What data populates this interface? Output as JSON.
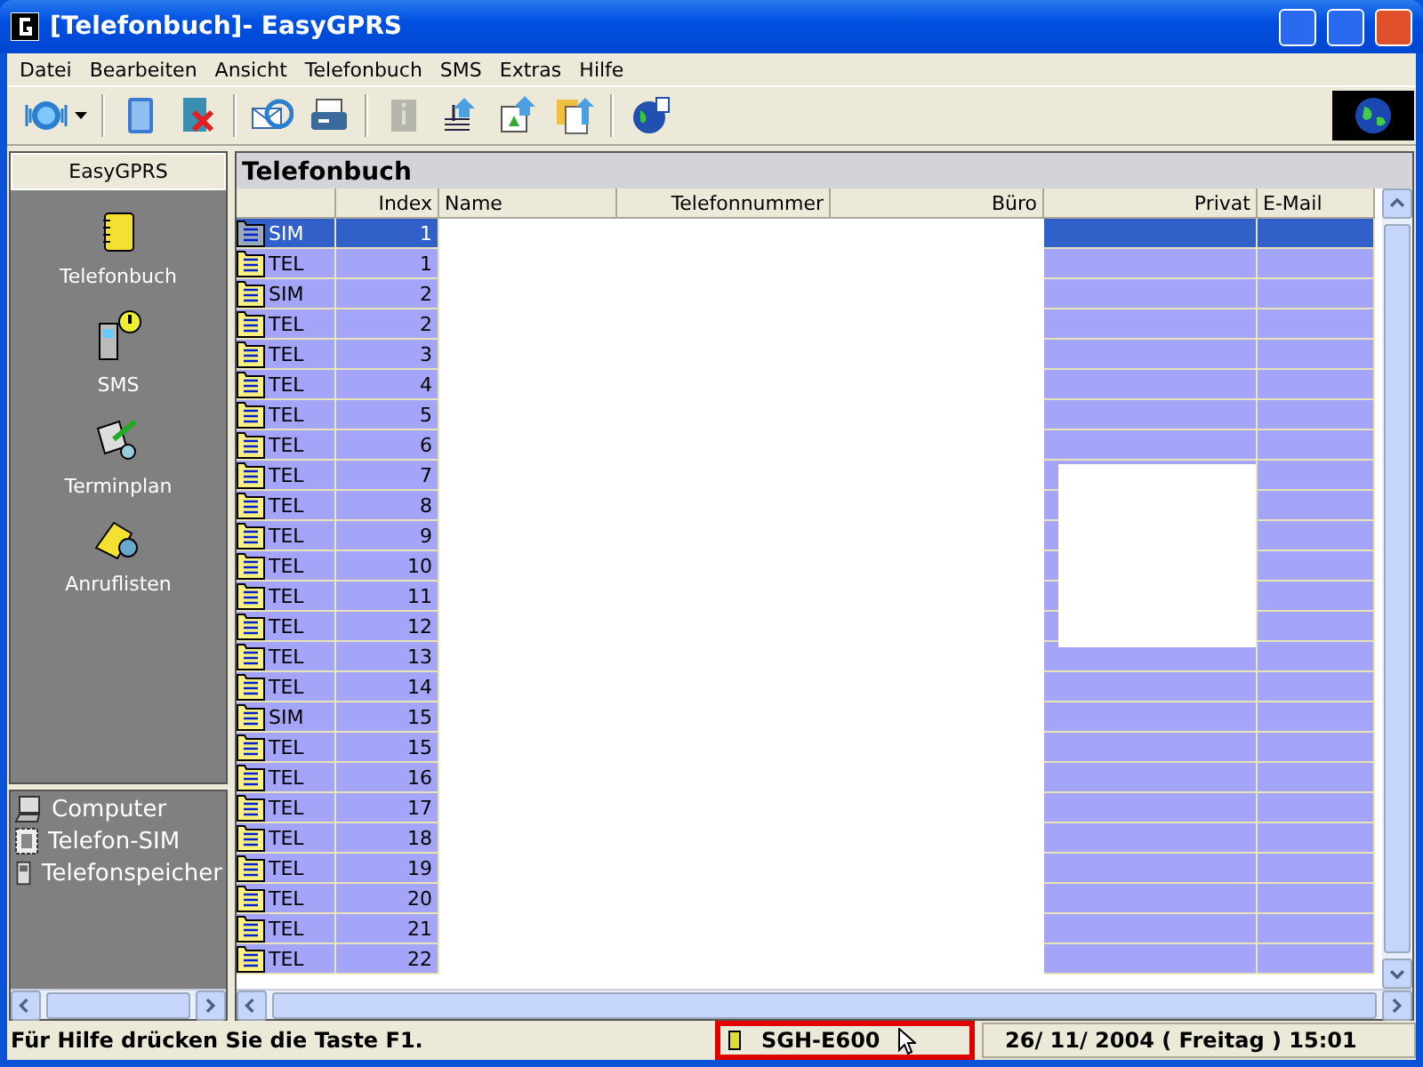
{
  "window": {
    "title": "[Telefonbuch]- EasyGPRS"
  },
  "menu": [
    "Datei",
    "Bearbeiten",
    "Ansicht",
    "Telefonbuch",
    "SMS",
    "Extras",
    "Hilfe"
  ],
  "toolbar": [
    {
      "kind": "connect"
    },
    {
      "kind": "dropdown"
    },
    {
      "kind": "sep"
    },
    {
      "kind": "book"
    },
    {
      "kind": "delete"
    },
    {
      "kind": "sep"
    },
    {
      "kind": "mail"
    },
    {
      "kind": "print"
    },
    {
      "kind": "sep"
    },
    {
      "kind": "info",
      "disabled": true
    },
    {
      "kind": "music"
    },
    {
      "kind": "image"
    },
    {
      "kind": "doc"
    },
    {
      "kind": "sep"
    },
    {
      "kind": "globe"
    }
  ],
  "sidebar": {
    "title": "EasyGPRS",
    "items": [
      {
        "kind": "book",
        "label": "Telefonbuch"
      },
      {
        "kind": "sms",
        "label": "SMS"
      },
      {
        "kind": "plan",
        "label": "Terminplan"
      },
      {
        "kind": "calls",
        "label": "Anruflisten"
      }
    ],
    "sources": [
      {
        "kind": "computer",
        "label": "Computer"
      },
      {
        "kind": "sim",
        "label": "Telefon-SIM"
      },
      {
        "kind": "phone",
        "label": "Telefonspeicher"
      }
    ]
  },
  "panel": {
    "title": "Telefonbuch"
  },
  "table": {
    "columns": [
      "Index",
      "Name",
      "Telefonnummer",
      "Büro",
      "Privat",
      "E-Mail"
    ],
    "rows": [
      {
        "type": "SIM",
        "index": "1",
        "selected": true
      },
      {
        "type": "TEL",
        "index": "1",
        "selected": false
      },
      {
        "type": "SIM",
        "index": "2",
        "selected": false
      },
      {
        "type": "TEL",
        "index": "2",
        "selected": false
      },
      {
        "type": "TEL",
        "index": "3",
        "selected": false
      },
      {
        "type": "TEL",
        "index": "4",
        "selected": false
      },
      {
        "type": "TEL",
        "index": "5",
        "selected": false
      },
      {
        "type": "TEL",
        "index": "6",
        "selected": false
      },
      {
        "type": "TEL",
        "index": "7",
        "selected": false
      },
      {
        "type": "TEL",
        "index": "8",
        "selected": false
      },
      {
        "type": "TEL",
        "index": "9",
        "selected": false
      },
      {
        "type": "TEL",
        "index": "10",
        "selected": false
      },
      {
        "type": "TEL",
        "index": "11",
        "selected": false
      },
      {
        "type": "TEL",
        "index": "12",
        "selected": false
      },
      {
        "type": "TEL",
        "index": "13",
        "selected": false
      },
      {
        "type": "TEL",
        "index": "14",
        "selected": false
      },
      {
        "type": "SIM",
        "index": "15",
        "selected": false
      },
      {
        "type": "TEL",
        "index": "15",
        "selected": false
      },
      {
        "type": "TEL",
        "index": "16",
        "selected": false
      },
      {
        "type": "TEL",
        "index": "17",
        "selected": false
      },
      {
        "type": "TEL",
        "index": "18",
        "selected": false
      },
      {
        "type": "TEL",
        "index": "19",
        "selected": false
      },
      {
        "type": "TEL",
        "index": "20",
        "selected": false
      },
      {
        "type": "TEL",
        "index": "21",
        "selected": false
      },
      {
        "type": "TEL",
        "index": "22",
        "selected": false
      }
    ]
  },
  "status_bar": {
    "help": "Für Hilfe drücken Sie die Taste F1.",
    "device": "SGH-E600",
    "date": "26/ 11/ 2004 ( Freitag ) 15:01"
  }
}
